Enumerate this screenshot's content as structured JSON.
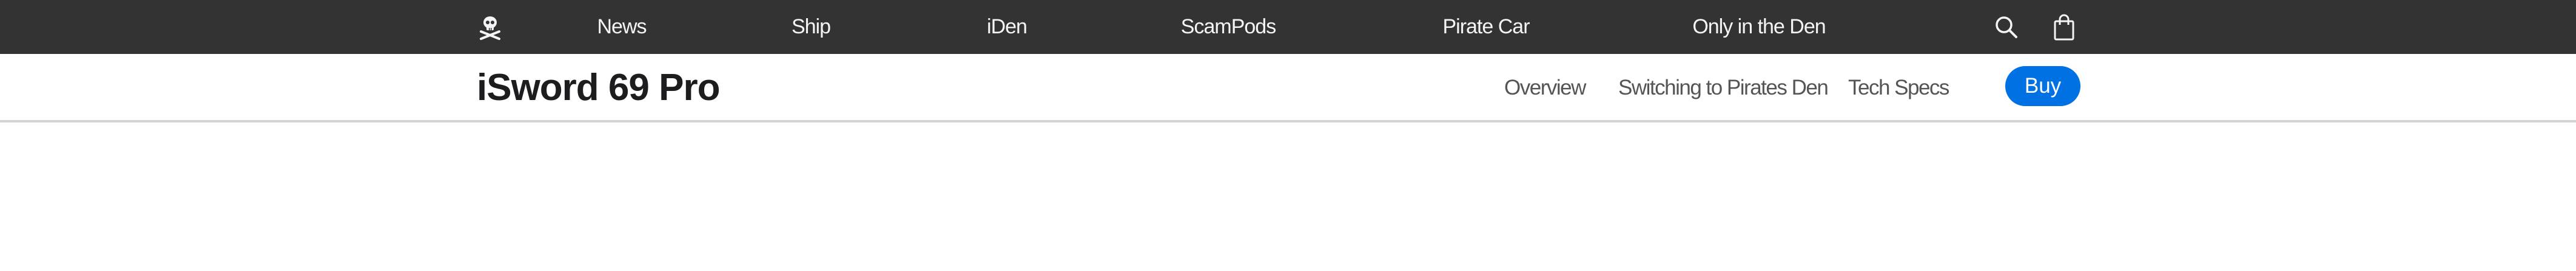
{
  "global_nav": {
    "logo_icon": "skull-and-crossbones-icon",
    "items": [
      {
        "label": "News"
      },
      {
        "label": "Ship"
      },
      {
        "label": "iDen"
      },
      {
        "label": "ScamPods"
      },
      {
        "label": "Pirate Car"
      },
      {
        "label": "Only in the Den"
      }
    ],
    "search_icon": "search-icon",
    "bag_icon": "shopping-bag-icon",
    "background_color": "#333333"
  },
  "local_nav": {
    "product_title": "iSword 69 Pro",
    "links": [
      {
        "label": "Overview"
      },
      {
        "label": "Switching to Pirates Den"
      },
      {
        "label": "Tech Specs"
      }
    ],
    "buy_label": "Buy",
    "buy_color": "#0071e3"
  }
}
